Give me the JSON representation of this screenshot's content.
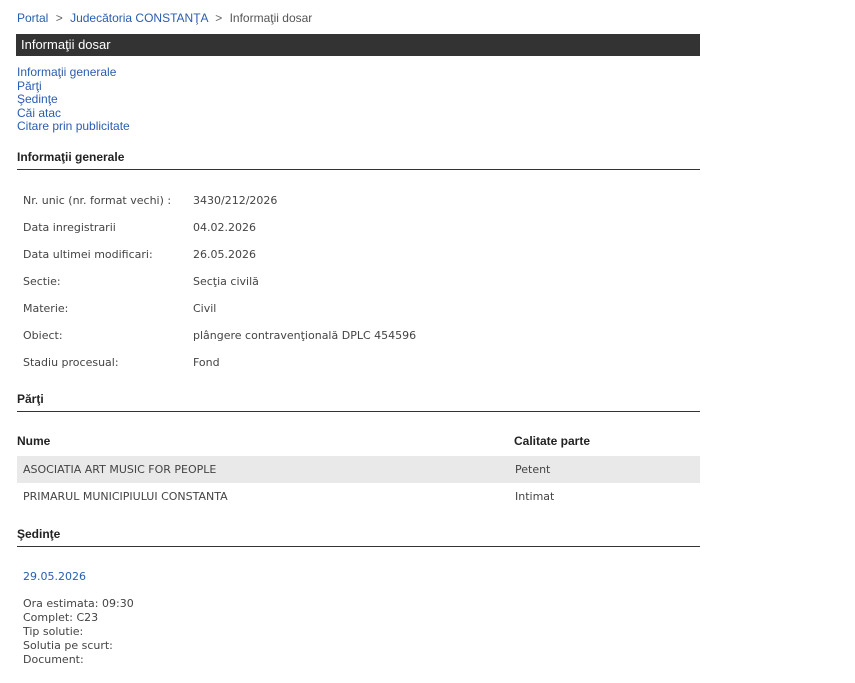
{
  "breadcrumb": {
    "portal": "Portal",
    "court": "Judecătoria CONSTANŢA",
    "current": "Informaţii dosar",
    "separator": ">"
  },
  "title": "Informaţii dosar",
  "toc": [
    "Informaţii generale",
    "Părţi",
    "Şedinţe",
    "Căi atac",
    "Citare prin publicitate"
  ],
  "general": {
    "heading": "Informaţii generale",
    "rows": [
      {
        "label": "Nr. unic (nr. format vechi) :",
        "value": "3430/212/2026"
      },
      {
        "label": "Data inregistrarii",
        "value": "04.02.2026"
      },
      {
        "label": "Data ultimei modificari:",
        "value": "26.05.2026"
      },
      {
        "label": "Sectie:",
        "value": "Secţia civilă"
      },
      {
        "label": "Materie:",
        "value": "Civil"
      },
      {
        "label": "Obiect:",
        "value": "plângere contravenţională DPLC 454596"
      },
      {
        "label": "Stadiu procesual:",
        "value": "Fond"
      }
    ]
  },
  "parties": {
    "heading": "Părţi",
    "col_name": "Nume",
    "col_role": "Calitate parte",
    "rows": [
      {
        "name": "ASOCIATIA ART MUSIC FOR PEOPLE",
        "role": "Petent"
      },
      {
        "name": "PRIMARUL MUNICIPIULUI CONSTANTA",
        "role": "Intimat"
      }
    ]
  },
  "hearings": {
    "heading": "Şedinţe",
    "date": "29.05.2026",
    "details": [
      "Ora estimata: 09:30",
      "Complet: C23",
      "Tip solutie:",
      "Solutia pe scurt:",
      "Document:"
    ]
  }
}
